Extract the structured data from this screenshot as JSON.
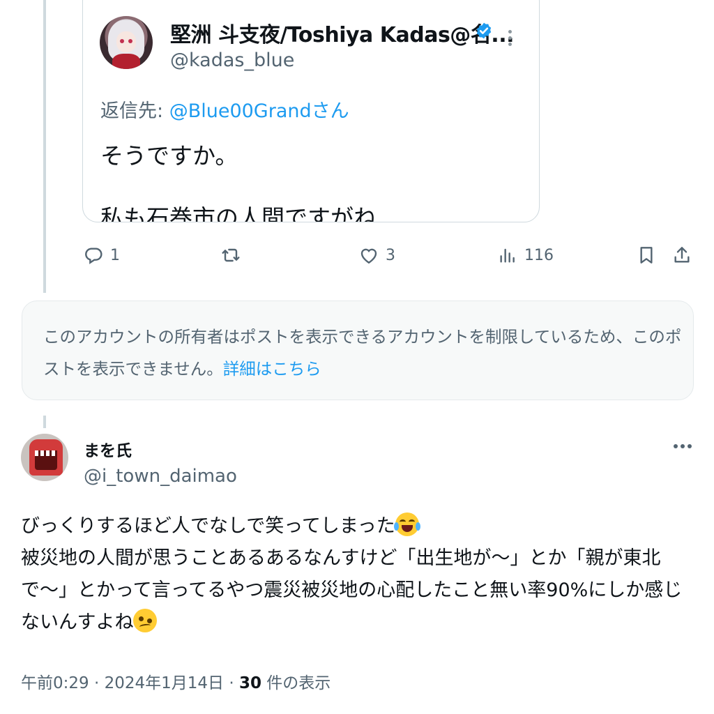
{
  "quoted_post": {
    "author_name": "堅洲 斗支夜/Toshiya Kadas@名...",
    "author_handle": "@kadas_blue",
    "reply_prefix": "返信先:",
    "reply_to": "@Blue00Grandさん",
    "text_line1": "そうですか。",
    "text_line2_partial": "私も石巻市の人間ですがね",
    "verified_icon": "verified-badge-icon",
    "colors": {
      "verified": "#1d9bf0",
      "link": "#1d9bf0"
    }
  },
  "actions": {
    "replies": "1",
    "reposts": "",
    "likes": "3",
    "views": "116"
  },
  "notice": {
    "text": "このアカウントの所有者はポストを表示できるアカウントを制限しているため、このポストを表示できません。",
    "link": "詳細はこちら"
  },
  "main_post": {
    "author_name": "まを氏",
    "author_handle": "@i_town_daimao",
    "line1": "びっくりするほど人でなしで笑ってしまった",
    "line1_emoji": "face-with-tears-of-joy",
    "line2": "被災地の人間が思うことあるあるなんすけど「出生地が〜」とか「親が東北で〜」とかって言ってるやつ震災被災地の心配したこと無い率90%にしか感じないんすよね",
    "line2_emoji": "woozy-face",
    "timestamp": "午前0:29 · 2024年1月14日 · ",
    "view_count": "30",
    "view_label": " 件の表示"
  }
}
